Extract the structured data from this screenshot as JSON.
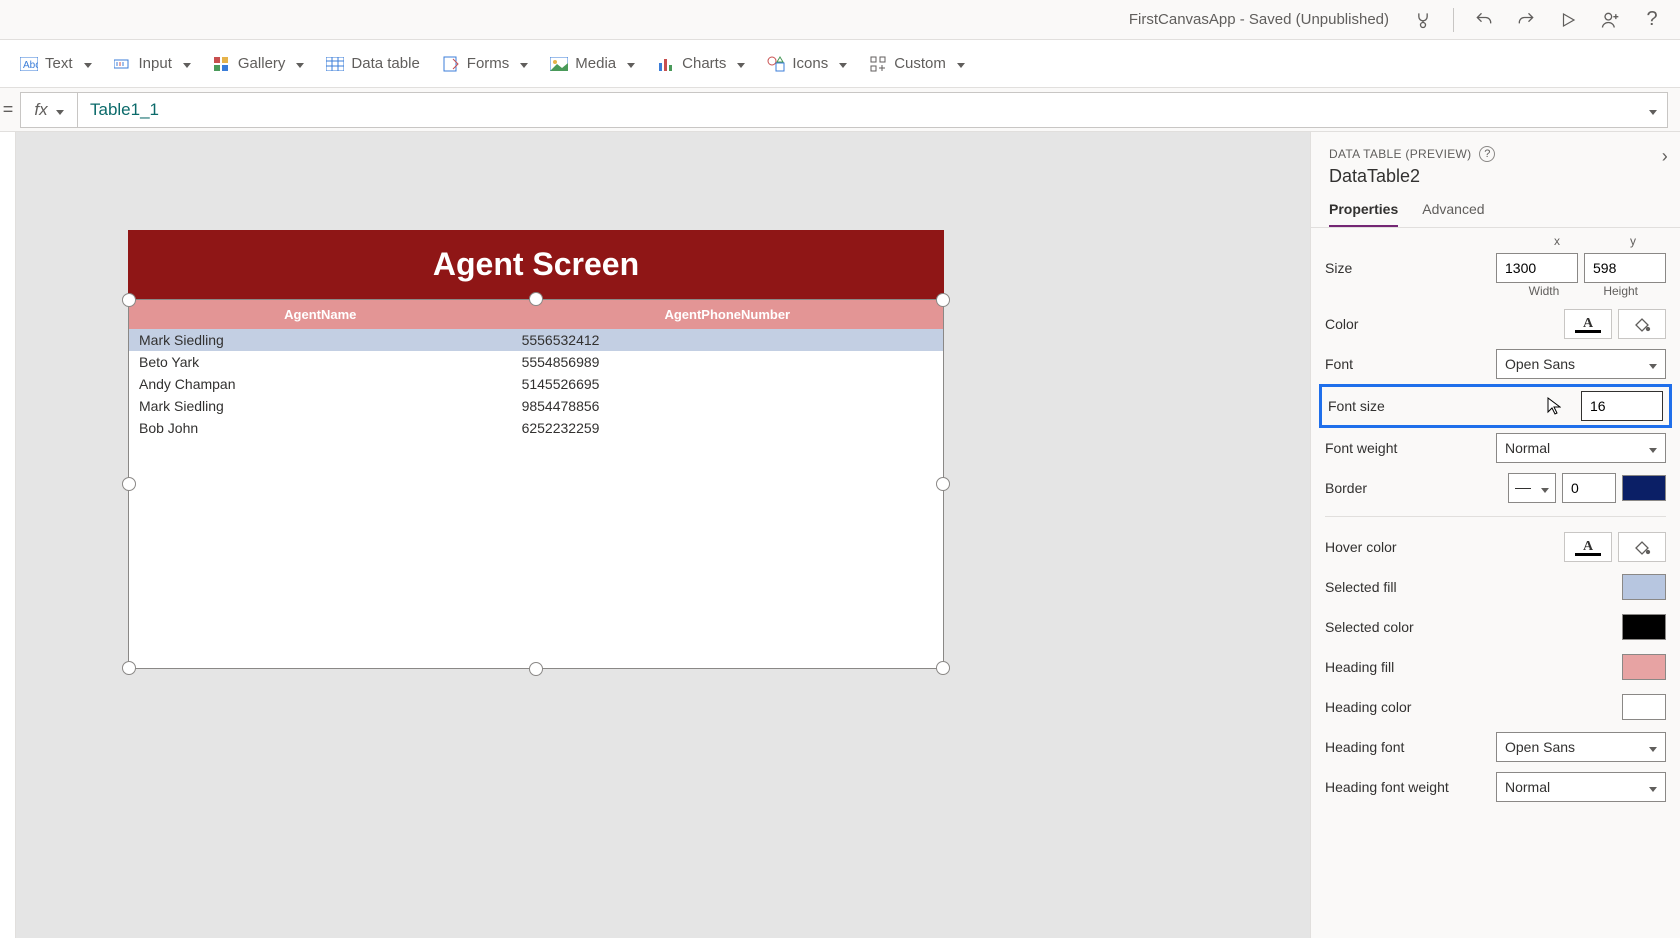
{
  "titlebar": {
    "title": "FirstCanvasApp - Saved (Unpublished)"
  },
  "toolbar": {
    "text": "Text",
    "input": "Input",
    "gallery": "Gallery",
    "datatable": "Data table",
    "forms": "Forms",
    "media": "Media",
    "charts": "Charts",
    "icons": "Icons",
    "custom": "Custom"
  },
  "formula": {
    "fx": "fx",
    "value": "Table1_1"
  },
  "canvas": {
    "header_title": "Agent Screen",
    "table": {
      "columns": [
        "AgentName",
        "AgentPhoneNumber"
      ],
      "rows": [
        {
          "name": "Mark Siedling",
          "phone": "5556532412",
          "selected": true
        },
        {
          "name": "Beto Yark",
          "phone": "5554856989",
          "selected": false
        },
        {
          "name": "Andy Champan",
          "phone": "5145526695",
          "selected": false
        },
        {
          "name": "Mark Siedling",
          "phone": "9854478856",
          "selected": false
        },
        {
          "name": "Bob John",
          "phone": "6252232259",
          "selected": false
        }
      ]
    }
  },
  "panel": {
    "header": "DATA TABLE (PREVIEW)",
    "control_name": "DataTable2",
    "tabs": {
      "properties": "Properties",
      "advanced": "Advanced"
    },
    "size_label": "Size",
    "size_w": "1300",
    "size_h": "598",
    "width_label": "Width",
    "height_label": "Height",
    "color_label": "Color",
    "font_label": "Font",
    "font_value": "Open Sans",
    "fontsize_label": "Font size",
    "fontsize_value": "16",
    "fontweight_label": "Font weight",
    "fontweight_value": "Normal",
    "border_label": "Border",
    "border_value": "0",
    "border_color": "#0b1f66",
    "hover_label": "Hover color",
    "selfill_label": "Selected fill",
    "selfill_color": "#b7c6e0",
    "selcolor_label": "Selected color",
    "selcolor_color": "#000000",
    "headfill_label": "Heading fill",
    "headfill_color": "#e7a3a3",
    "headcolor_label": "Heading color",
    "headcolor_color": "#ffffff",
    "headfont_label": "Heading font",
    "headfont_value": "Open Sans",
    "headfw_label": "Heading font weight",
    "headfw_value": "Normal"
  }
}
